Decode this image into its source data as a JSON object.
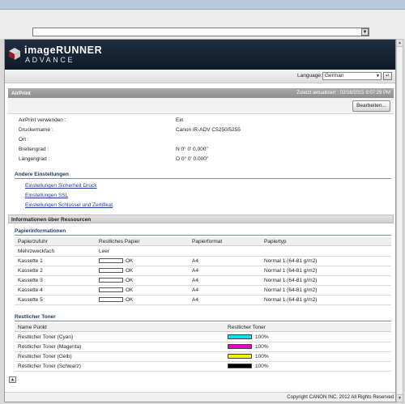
{
  "address_bar": {
    "dropdown_icon": "chevron-down-icon"
  },
  "banner": {
    "brand": "imageRUNNER",
    "sub": "ADVANCE"
  },
  "language": {
    "label": "Language",
    "selected": "German",
    "go_icon": "return-arrow-icon"
  },
  "airprint": {
    "title": "AirPrint",
    "updated": "Zuletzt aktualisiert : 02/16/2015 9:07:29 PM",
    "edit_button": "Bearbeiten...",
    "fields": [
      {
        "label": "AirPrint verwenden :",
        "value": "Ein"
      },
      {
        "label": "Druckername :",
        "value": "Canon iR-ADV C5250/5255"
      },
      {
        "label": "Ort :",
        "value": ""
      },
      {
        "label": "Breitengrad :",
        "value": "N 0° 0' 0.000\""
      },
      {
        "label": "Längengrad :",
        "value": "O 0° 0' 0.000\""
      }
    ]
  },
  "other_settings": {
    "title": "Andere Einstellungen",
    "links": [
      "Einstellungen Sicherheit Druck",
      "Einstellungen SSL",
      "Einstellungen Schlüssel und Zertifikat"
    ]
  },
  "resources": {
    "title": "Informationen über Ressourcen"
  },
  "paper": {
    "title": "Papierinformationen",
    "columns": [
      "Papierzufuhr",
      "Restliches Papier",
      "Papierformat",
      "Papiertyp"
    ],
    "rows": [
      {
        "source": "Mehrzweckfach",
        "remaining": "Leer",
        "show_gauge": false,
        "level": 0,
        "format": "",
        "type": ""
      },
      {
        "source": "Kassette 1",
        "remaining": "OK",
        "show_gauge": true,
        "level": 0,
        "format": "A4",
        "type": "Normal 1 (64-81 g/m2)"
      },
      {
        "source": "Kassette 2",
        "remaining": "OK",
        "show_gauge": true,
        "level": 0,
        "format": "A4",
        "type": "Normal 1 (64-81 g/m2)"
      },
      {
        "source": "Kassette 3",
        "remaining": "OK",
        "show_gauge": true,
        "level": 0,
        "format": "A4",
        "type": "Normal 1 (64-81 g/m2)"
      },
      {
        "source": "Kassette 4",
        "remaining": "OK",
        "show_gauge": true,
        "level": 0,
        "format": "A4",
        "type": "Normal 1 (64-81 g/m2)"
      },
      {
        "source": "Kassette 5",
        "remaining": "OK",
        "show_gauge": true,
        "level": 0,
        "format": "A4",
        "type": "Normal 1 (64-81 g/m2)"
      }
    ]
  },
  "toner": {
    "title": "Restlicher Toner",
    "columns": [
      "Name Punkt",
      "Restlicher Toner"
    ],
    "rows": [
      {
        "name": "Restlicher Toner (Cyan)",
        "value": "100%",
        "color": "#00e5f0",
        "level": 1.0
      },
      {
        "name": "Restlicher Toner (Magenta)",
        "value": "100%",
        "color": "#ee00cc",
        "level": 1.0
      },
      {
        "name": "Restlicher Toner (Gelb)",
        "value": "100%",
        "color": "#f2f200",
        "level": 1.0
      },
      {
        "name": "Restlicher Toner (Schwarz)",
        "value": "100%",
        "color": "#000000",
        "level": 1.0
      }
    ]
  },
  "footer": {
    "copyright": "Copyright CANON INC. 2012 All Rights Reserved",
    "top_icon": "arrow-up-icon"
  }
}
